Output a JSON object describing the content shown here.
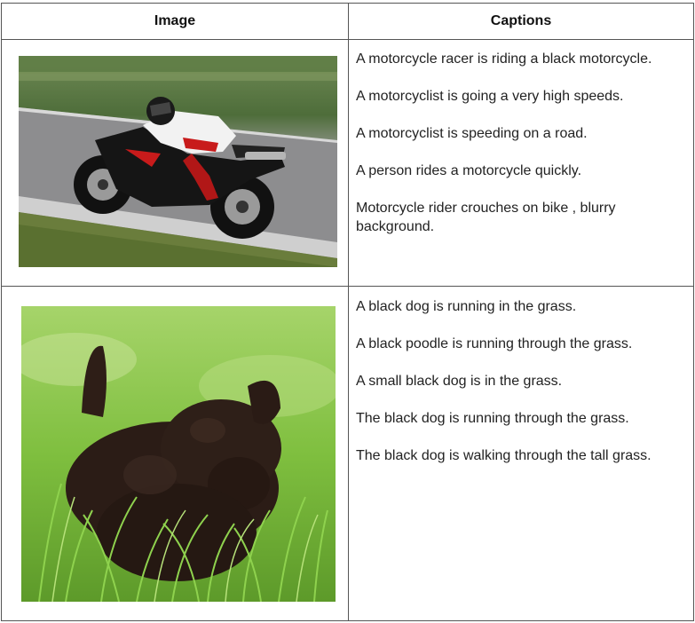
{
  "table": {
    "header": {
      "image_col": "Image",
      "captions_col": "Captions"
    },
    "rows": [
      {
        "image_icon": "motorcycle-racer-photo",
        "captions": [
          "A motorcycle racer is riding a black motorcycle.",
          "A motorcyclist is going a very high speeds.",
          "A motorcyclist is speeding on a road.",
          "A person rides a motorcycle quickly.",
          "Motorcycle rider crouches on bike , blurry background."
        ]
      },
      {
        "image_icon": "black-dog-in-grass-photo",
        "captions": [
          "A black dog is running in the grass.",
          "A black poodle is running through the grass.",
          "A small black dog is in the grass.",
          "The black dog is running through the grass.",
          "The black dog is walking through the tall grass."
        ]
      }
    ]
  }
}
